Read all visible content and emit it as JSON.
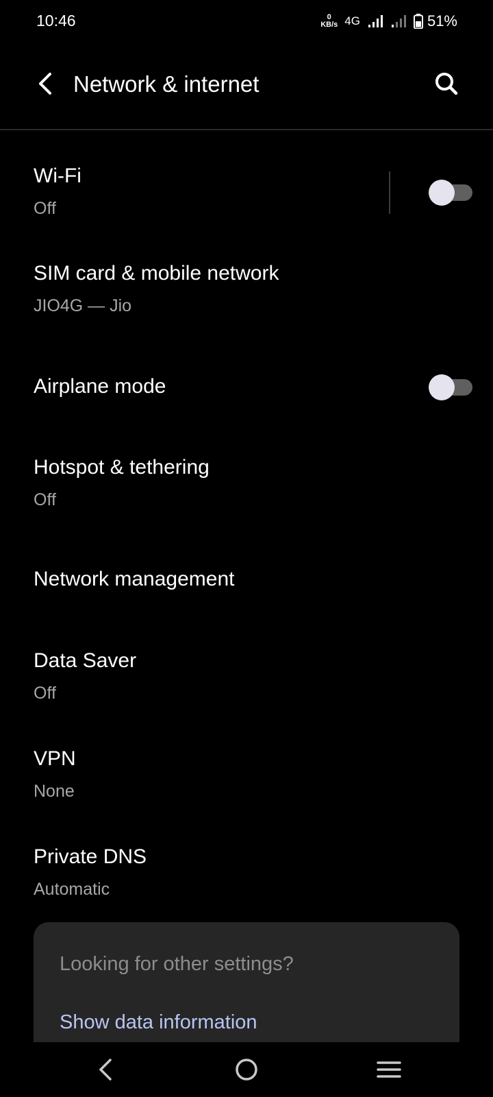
{
  "status_bar": {
    "time": "10:46",
    "kbs_value": "0",
    "kbs_unit": "KB/s",
    "network_type": "4G",
    "battery_percent": "51%",
    "icons": [
      "signal-icon",
      "signal-weak-icon",
      "battery-icon"
    ]
  },
  "header": {
    "title": "Network & internet",
    "back_icon": "back-arrow-icon",
    "search_icon": "search-icon"
  },
  "settings": {
    "wifi": {
      "title": "Wi-Fi",
      "subtitle": "Off",
      "toggle_on": false
    },
    "sim": {
      "title": "SIM card & mobile network",
      "subtitle": "JIO4G — Jio"
    },
    "airplane": {
      "title": "Airplane mode",
      "toggle_on": false
    },
    "hotspot": {
      "title": "Hotspot & tethering",
      "subtitle": "Off"
    },
    "network_management": {
      "title": "Network management"
    },
    "data_saver": {
      "title": "Data Saver",
      "subtitle": "Off"
    },
    "vpn": {
      "title": "VPN",
      "subtitle": "None"
    },
    "private_dns": {
      "title": "Private DNS",
      "subtitle": "Automatic"
    }
  },
  "card": {
    "title": "Looking for other settings?",
    "link": "Show data information"
  },
  "colors": {
    "background": "#000000",
    "card_background": "#262626",
    "link": "#b8c4f4",
    "subtitle": "#a7a7a7",
    "toggle_track_off": "#5f5f5f",
    "toggle_thumb": "#e4e3ee"
  },
  "nav_bar": {
    "icons": [
      "nav-back-icon",
      "nav-home-icon",
      "nav-recents-icon"
    ]
  }
}
